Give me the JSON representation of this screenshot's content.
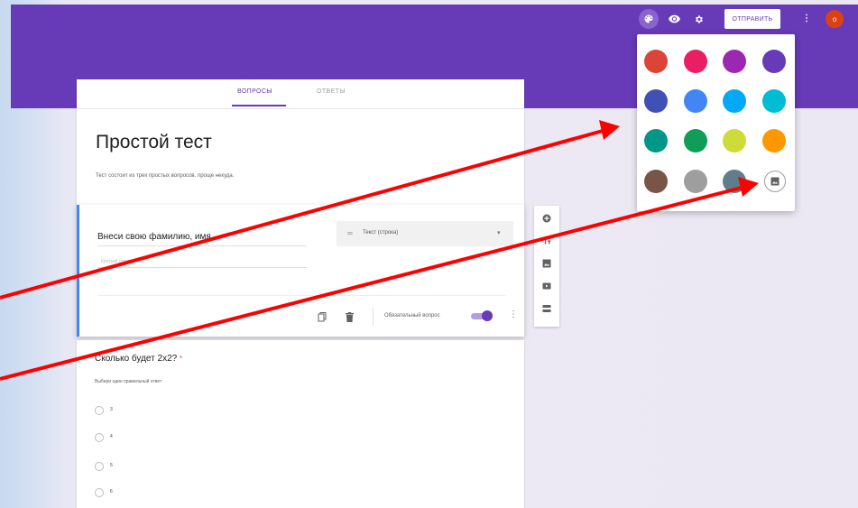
{
  "toolbar": {
    "send_label": "ОТПРАВИТЬ",
    "avatar_letter": "о",
    "more_icon": "more-vert-icon"
  },
  "tabs": {
    "questions": "ВОПРОСЫ",
    "answers": "ОТВЕТЫ"
  },
  "form": {
    "title": "Простой тест",
    "description": "Тест состоит из трех простых вопросов, проще некуда."
  },
  "question1": {
    "title": "Внеси свою фамилию, имя",
    "placeholder": "Краткий ответ",
    "type_label": "Текст (строка)",
    "required_label": "Обязательный вопрос",
    "required_on": true
  },
  "question2": {
    "title": "Сколько будет 2х2?",
    "required_mark": "*",
    "description": "Выбери один правильный ответ",
    "options": [
      "3",
      "4",
      "5",
      "6"
    ]
  },
  "palette": {
    "colors": [
      "#db4437",
      "#e91e63",
      "#9c27b0",
      "#673ab7",
      "#3f51b5",
      "#4285f4",
      "#03a9f4",
      "#00bcd4",
      "#009688",
      "#0f9d58",
      "#cddc39",
      "#ff9800",
      "#795548",
      "#9e9e9e",
      "#607d8b"
    ],
    "custom_icon": "image-icon"
  },
  "colors": {
    "accent": "#673ab7",
    "annotation_arrow": "#ff0000"
  }
}
